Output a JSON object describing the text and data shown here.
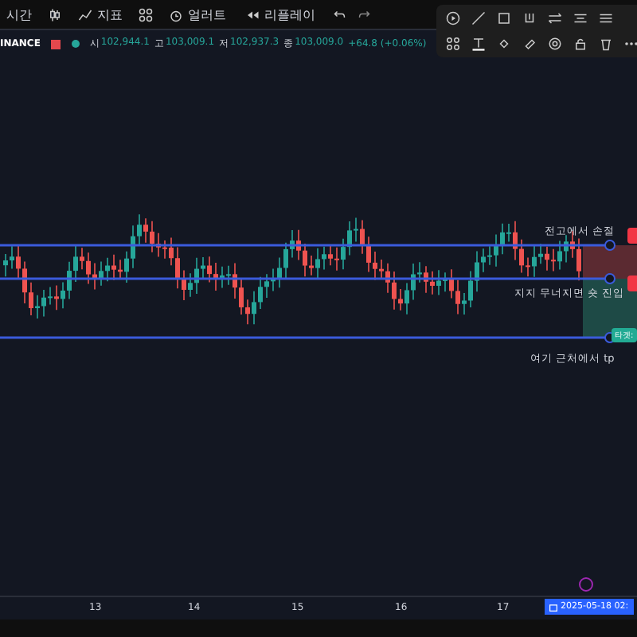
{
  "toolbar": {
    "items": [
      {
        "label": "시간",
        "kind": "dropdown"
      },
      {
        "label": "지표",
        "kind": "indicator"
      },
      {
        "label": "얼러트",
        "kind": "alert"
      },
      {
        "label": "리플레이",
        "kind": "replay"
      }
    ]
  },
  "symbol": {
    "exchange": "INANCE",
    "ohlc": [
      {
        "key": "시",
        "value": "102,944.1"
      },
      {
        "key": "고",
        "value": "103,009.1"
      },
      {
        "key": "저",
        "value": "102,937.3"
      },
      {
        "key": "종",
        "value": "103,009.0"
      }
    ],
    "change": "+64.8 (+0.06%)"
  },
  "annotations": [
    {
      "text": "전고에서 손절"
    },
    {
      "text": "지지 무너지면 숏 진입"
    },
    {
      "text": "여기 근처에서 tp"
    }
  ],
  "target_label": "타겟:",
  "time_axis": {
    "ticks": [
      "13",
      "14",
      "15",
      "16",
      "17"
    ],
    "cursor_date": "2025-05-18 02:"
  }
}
